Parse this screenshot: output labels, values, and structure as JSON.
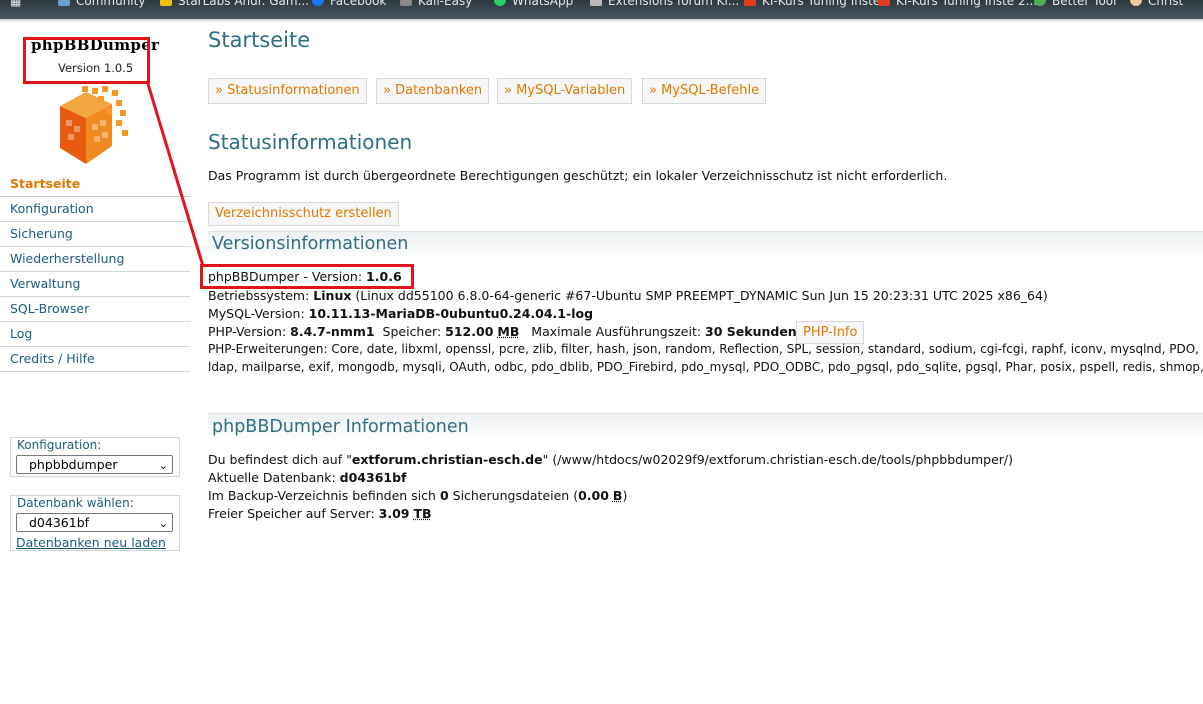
{
  "bookmarks": [
    "Community",
    "StarLabs Andr. Gam...",
    "Facebook",
    "Kali-Easy",
    "WhatsApp",
    "Extensions forum Kl...",
    "KI-Kurs Tuning Inste",
    "KI-Kurs Tuning Inste 2...",
    "Better Tool",
    "Christ"
  ],
  "sidebar": {
    "app_name": "phpBBDumper",
    "version": "Version 1.0.5",
    "nav": [
      "Startseite",
      "Konfiguration",
      "Sicherung",
      "Wiederherstellung",
      "Verwaltung",
      "SQL-Browser",
      "Log",
      "Credits / Hilfe"
    ],
    "config_label": "Konfiguration:",
    "config_value": "phpbbdumper",
    "db_label": "Datenbank wählen:",
    "db_value": "d04361bf",
    "reload_link": "Datenbanken neu laden"
  },
  "main": {
    "title": "Startseite",
    "tabs": [
      "» Statusinformationen",
      "» Datenbanken",
      "» MySQL-Variablen",
      "» MySQL-Befehle"
    ],
    "status_heading": "Statusinformationen",
    "status_text": "Das Programm ist durch übergeordnete Berechtigungen geschützt; ein lokaler Verzeichnisschutz ist nicht erforderlich.",
    "protect_button": "Verzeichnisschutz erstellen",
    "version_heading": "Versionsinformationen",
    "version_label": "phpBBDumper - Version: ",
    "version_value": "1.0.6",
    "os_label": "Betriebssystem: ",
    "os_value": "Linux",
    "os_detail": " (Linux dd55100 6.8.0-64-generic #67-Ubuntu SMP PREEMPT_DYNAMIC Sun Jun 15 20:23:31 UTC 2025 x86_64)",
    "mysql_label": "MySQL-Version: ",
    "mysql_value": "10.11.13-MariaDB-0ubuntu0.24.04.1-log",
    "php_label": "PHP-Version: ",
    "php_value": "8.4.7-nmm1",
    "mem_label": "Speicher: ",
    "mem_value": "512.00",
    "mem_unit": "MB",
    "exec_label": "Maximale Ausführungszeit: ",
    "exec_value": "30 Sekunden",
    "phpinfo_button": "PHP-Info",
    "ext_label": "PHP-Erweiterungen: ",
    "ext_line1": "Core, date, libxml, openssl, pcre, zlib, filter, hash, json, random, Reflection, SPL, session, standard, sodium, cgi-fcgi, raphf, iconv, mysqlnd, PDO, xml, bcmath",
    "ext_line2": "ldap, mailparse, exif, mongodb, mysqli, OAuth, odbc, pdo_dblib, PDO_Firebird, pdo_mysql, PDO_ODBC, pdo_pgsql, pdo_sqlite, pgsql, Phar, posix, pspell, redis, shmop, SimpleXML",
    "info_heading": "phpBBDumper Informationen",
    "loc_pre": "Du befindest dich auf \"",
    "loc_host": "extforum.christian-esch.de",
    "loc_post": "\" (/www/htdocs/w02029f9/extforum.christian-esch.de/tools/phpbbdumper/)",
    "curdb_label": "Aktuelle Datenbank: ",
    "curdb_value": "d04361bf",
    "backup_pre": "Im Backup-Verzeichnis befinden sich ",
    "backup_count": "0",
    "backup_mid": " Sicherungsdateien (",
    "backup_size": "0.00",
    "backup_unit": "B",
    "backup_post": ")",
    "free_label": "Freier Speicher auf Server: ",
    "free_value": "3.09",
    "free_unit": "TB"
  },
  "colors": {
    "accent": "#e07800",
    "heading": "#2f6f85",
    "link": "#1c5c80",
    "highlight_box": "#e0161a"
  }
}
